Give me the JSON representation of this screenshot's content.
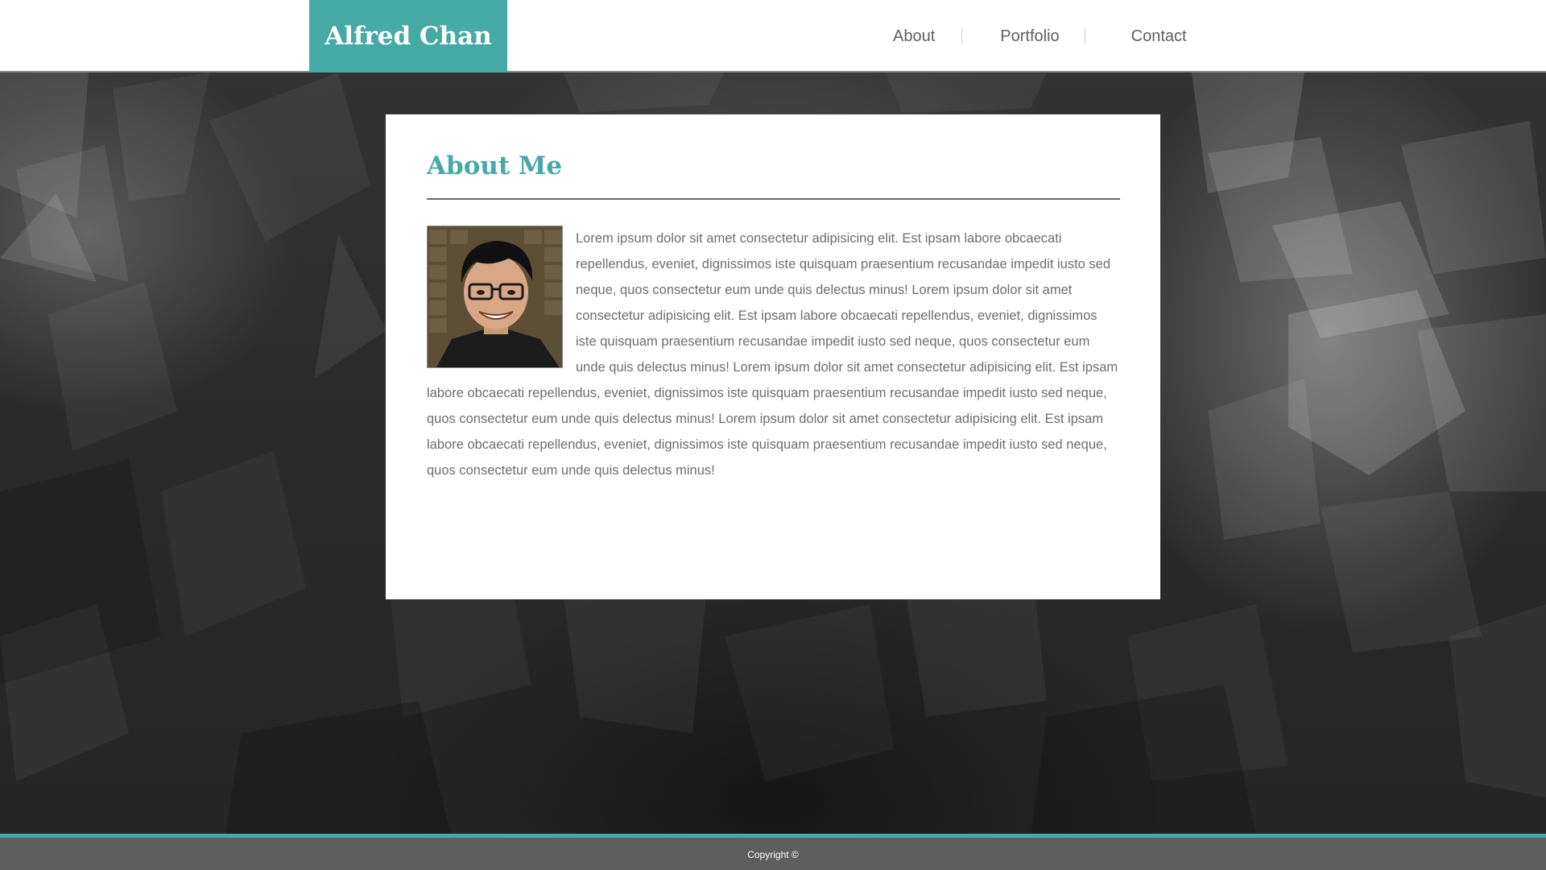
{
  "brand": {
    "name": "Alfred Chan",
    "accent_color": "#45a9a6"
  },
  "nav": {
    "items": [
      {
        "label": "About"
      },
      {
        "label": "Portfolio"
      },
      {
        "label": "Contact"
      }
    ]
  },
  "about": {
    "title": "About Me",
    "photo_icon": "profile-photo",
    "body": "Lorem ipsum dolor sit amet consectetur adipisicing elit. Est ipsam labore obcaecati repellendus, eveniet, dignissimos iste quisquam praesentium recusandae impedit iusto sed neque, quos consectetur eum unde quis delectus minus! Lorem ipsum dolor sit amet consectetur adipisicing elit. Est ipsam labore obcaecati repellendus, eveniet, dignissimos iste quisquam praesentium recusandae impedit iusto sed neque, quos consectetur eum unde quis delectus minus! Lorem ipsum dolor sit amet consectetur adipisicing elit. Est ipsam labore obcaecati repellendus, eveniet, dignissimos iste quisquam praesentium recusandae impedit iusto sed neque, quos consectetur eum unde quis delectus minus! Lorem ipsum dolor sit amet consectetur adipisicing elit. Est ipsam labore obcaecati repellendus, eveniet, dignissimos iste quisquam praesentium recusandae impedit iusto sed neque, quos consectetur eum unde quis delectus minus!"
  },
  "footer": {
    "copyright": "Copyright ©"
  }
}
